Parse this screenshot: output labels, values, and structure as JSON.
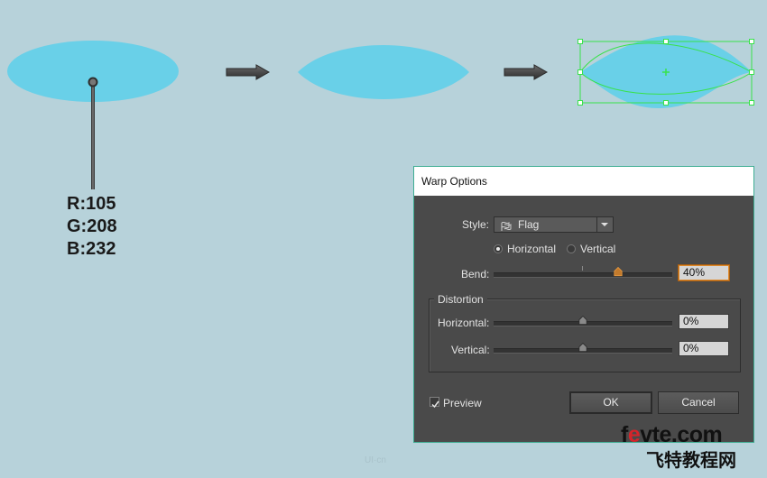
{
  "illustration": {
    "color_label": [
      "R:105",
      "G:208",
      "B:232"
    ],
    "fill_color": "#69d0e8",
    "selection_color": "#38e24a",
    "steps": [
      "ellipse",
      "leaf",
      "warped-leaf"
    ]
  },
  "dialog": {
    "title": "Warp Options",
    "style_label": "Style:",
    "style_value": "Flag",
    "orientation": {
      "horizontal_label": "Horizontal",
      "vertical_label": "Vertical",
      "selected": "Horizontal"
    },
    "bend_label": "Bend:",
    "bend_value": "40%",
    "bend_fraction": 0.7,
    "distortion": {
      "title": "Distortion",
      "horizontal_label": "Horizontal:",
      "horizontal_value": "0%",
      "vertical_label": "Vertical:",
      "vertical_value": "0%"
    },
    "preview_label": "Preview",
    "preview_checked": true,
    "ok_label": "OK",
    "cancel_label": "Cancel"
  },
  "watermark": {
    "site_prefix": "f",
    "site_e": "e",
    "site_rest": "vte.com",
    "site_cn": "飞特教程网",
    "brand_small": "UI·cn"
  }
}
